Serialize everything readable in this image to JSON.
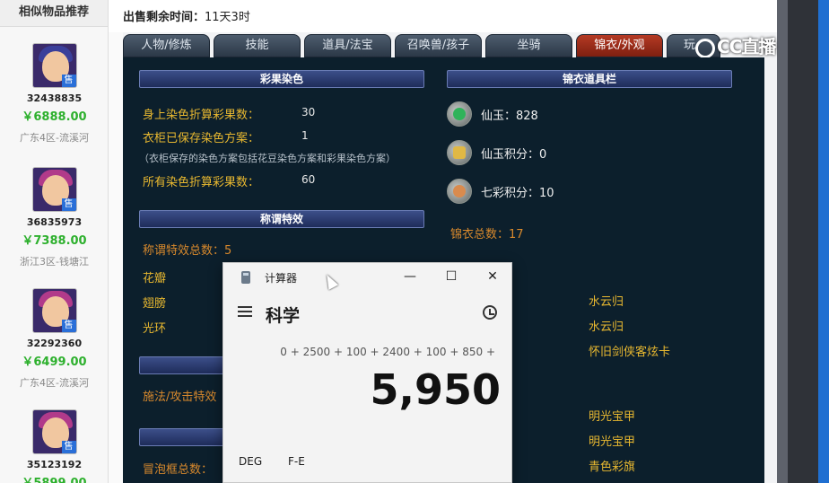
{
  "sidebar": {
    "title": "相似物品推荐",
    "products": [
      {
        "id": "32438835",
        "price": "￥6888.00",
        "server": "广东4区-流溪河",
        "badge": "售"
      },
      {
        "id": "36835973",
        "price": "￥7388.00",
        "server": "浙江3区-钱塘江",
        "badge": "售"
      },
      {
        "id": "32292360",
        "price": "￥6499.00",
        "server": "广东4区-流溪河",
        "badge": "售"
      },
      {
        "id": "35123192",
        "price": "￥5899.00",
        "server": "",
        "badge": "售"
      }
    ]
  },
  "header": {
    "sale_time_label": "出售剩余时间：",
    "sale_time_value": "11天3时"
  },
  "tabs": [
    "人物/修炼",
    "技能",
    "道具/法宝",
    "召唤兽/孩子",
    "坐骑",
    "锦衣/外观",
    "玩"
  ],
  "active_tab": "锦衣/外观",
  "dye_section": {
    "title": "彩果染色",
    "rows": [
      {
        "label": "身上染色折算彩果数：",
        "value": "30"
      },
      {
        "label": "衣柜已保存染色方案：",
        "value": "1"
      },
      {
        "label": "所有染色折算彩果数：",
        "value": "60"
      }
    ],
    "note": "（衣柜保存的染色方案包括花豆染色方案和彩果染色方案）"
  },
  "title_section": {
    "title": "称谓特效",
    "total_label": "称谓特效总数：5",
    "items": [
      "花瓣",
      "翅膀",
      "光环"
    ]
  },
  "cast_section": {
    "title": "",
    "total_label": "施法/攻击特效"
  },
  "bubble_section": {
    "title": "",
    "total_label": "冒泡框总数："
  },
  "jinyi_panel": {
    "title": "锦衣道具栏",
    "items": [
      {
        "icon": "jade-coin-icon",
        "label": "仙玉：828"
      },
      {
        "icon": "jade-points-icon",
        "label": "仙玉积分：0"
      },
      {
        "icon": "rainbow-points-icon",
        "label": "七彩积分：10"
      }
    ],
    "total_label": "锦衣总数：17",
    "right_items": [
      "水云归",
      "水云归",
      "怀旧剑侠客炫卡",
      "明光宝甲",
      "明光宝甲",
      "青色彩旗"
    ]
  },
  "calculator": {
    "app_title": "计算器",
    "mode": "科学",
    "expression": "0 + 2500 + 100 + 2400 + 100 + 850 +",
    "result": "5,950",
    "angle_mode": "DEG",
    "fe_label": "F-E",
    "minimize": "—",
    "maximize": "☐",
    "close": "✕"
  },
  "watermark": "CC直播",
  "colors": {
    "panel_bg": "#0c1f2c",
    "label_gold": "#e8b830",
    "orange": "#d8892c",
    "active_tab": "#b53a24",
    "price_green": "#2db02d"
  }
}
